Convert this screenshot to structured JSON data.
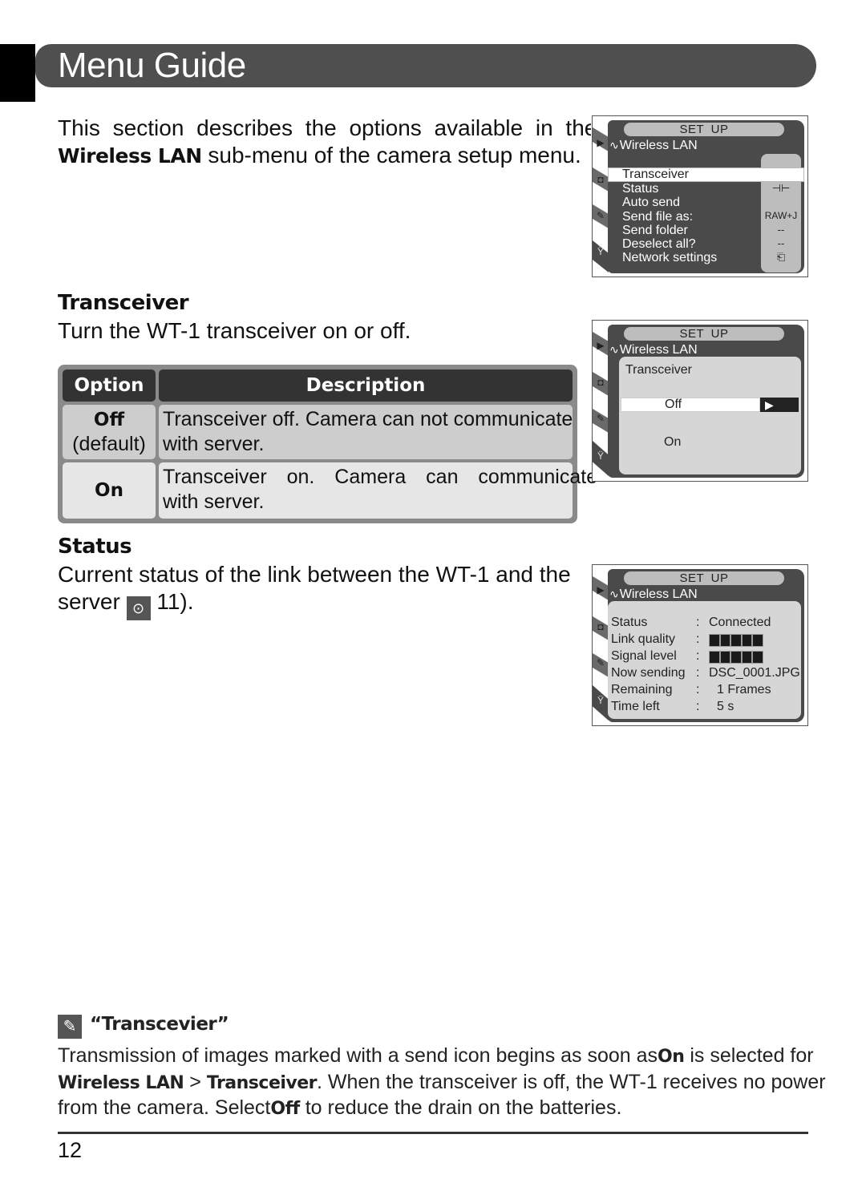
{
  "header": {
    "title": "Menu Guide"
  },
  "intro": {
    "line1": "This section describes the options available in the",
    "bold_term": "Wireless LAN",
    "line2_rest": " sub-menu of the camera setup menu."
  },
  "sections": {
    "transceiver": {
      "heading": "Transceiver",
      "description": "Turn the WT-1 transceiver on or off.",
      "table": {
        "headers": [
          "Option",
          "Description"
        ],
        "rows": [
          {
            "option": "Off",
            "option_sub": "(default)",
            "desc_line1": "Transceiver off.  Camera can not communicate",
            "desc_line2": "with server."
          },
          {
            "option": "On",
            "option_sub": "",
            "desc_line1": "Transceiver on.  Camera can communicate",
            "desc_line2": "with server."
          }
        ]
      }
    },
    "status": {
      "heading": "Status",
      "description_line1": "Current status of the link between the WT-1 and the",
      "description_line2_pre": "server ",
      "page_ref": "11).",
      "ref_icon": "see-also-icon"
    }
  },
  "screens": {
    "common": {
      "menu": "SET UP",
      "submenu": "Wireless LAN",
      "side_icons": [
        "playback-icon",
        "camera-icon",
        "pencil-icon",
        "wrench-icon"
      ]
    },
    "menu_list": {
      "items": [
        "Transceiver",
        "Status",
        "Auto send",
        "Send file as:",
        "Send folder",
        "Deselect all?",
        "Network settings"
      ],
      "highlighted": "Transceiver",
      "values": [
        "",
        "⊣⊢",
        "",
        "RAW+J",
        "--",
        "--",
        "⎗"
      ]
    },
    "transceiver_select": {
      "label": "Transceiver",
      "options": [
        "Off",
        "On"
      ],
      "selected": "Off",
      "arrow": "▶"
    },
    "status_screen": {
      "rows": [
        {
          "key": "Status",
          "value": "Connected"
        },
        {
          "key": "Link quality",
          "value": "",
          "bars": 5
        },
        {
          "key": "Signal level",
          "value": "",
          "bars": 5
        },
        {
          "key": "Now sending",
          "value": "DSC_0001.JPG"
        },
        {
          "key": "Remaining",
          "value": "1 Frames"
        },
        {
          "key": "Time left",
          "value": "5 s"
        }
      ],
      "separator": ":"
    }
  },
  "note": {
    "icon": "pencil-note-icon",
    "title": "“Transcevier”",
    "p1_pre": "Transmission of images marked with a send icon begins as soon as",
    "p1_bold": "On",
    "p1_post": " is selected for",
    "p2_bold1": "Wireless LAN",
    "p2_sep": " > ",
    "p2_bold2": "Transceiver",
    "p2_post": ".  When the transceiver is off, the WT-1 receives no power",
    "p3_pre": "from the camera.  Select",
    "p3_bold": "Off",
    "p3_post": " to reduce the drain on the batteries."
  },
  "footer": {
    "page_number": "12"
  }
}
